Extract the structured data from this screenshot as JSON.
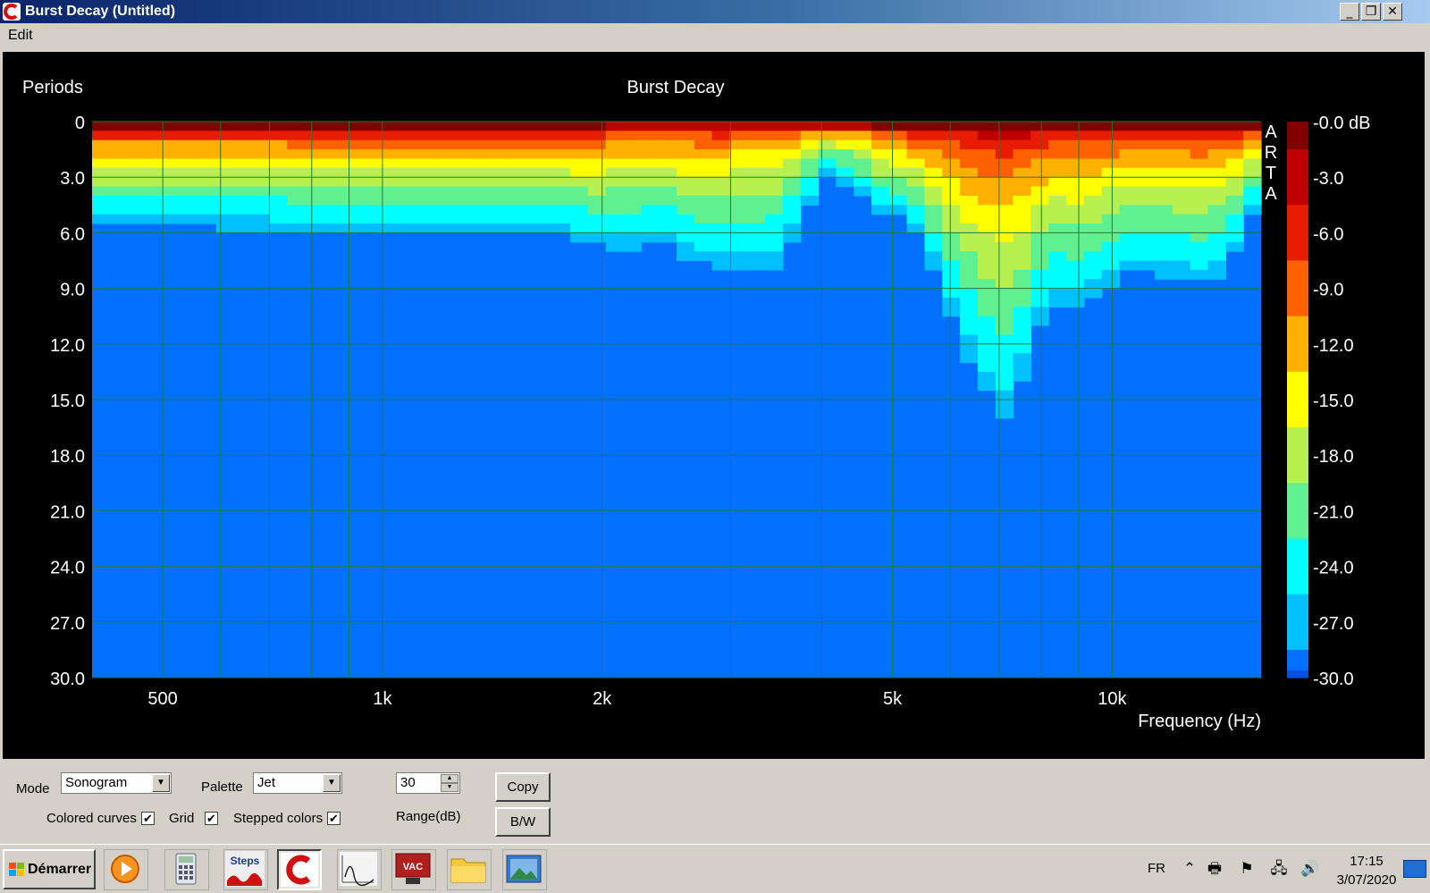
{
  "window": {
    "title": "Burst Decay  (Untitled)",
    "minimize_glyph": "_",
    "restore_glyph": "❐",
    "close_glyph": "✕"
  },
  "menu": {
    "edit_label": "Edit"
  },
  "chart_data": {
    "type": "heatmap",
    "title": "Burst Decay",
    "ylabel": "Periods",
    "xlabel": "Frequency (Hz)",
    "x_scale": "log",
    "xlim": [
      400,
      16000
    ],
    "ylim": [
      0,
      30
    ],
    "y_inverted": true,
    "x_ticks": [
      {
        "value": 500,
        "label": "500"
      },
      {
        "value": 1000,
        "label": "1k"
      },
      {
        "value": 2000,
        "label": "2k"
      },
      {
        "value": 5000,
        "label": "5k"
      },
      {
        "value": 10000,
        "label": "10k"
      }
    ],
    "x_grid": [
      500,
      600,
      700,
      800,
      900,
      1000,
      2000,
      3000,
      4000,
      5000,
      6000,
      7000,
      8000,
      9000,
      10000
    ],
    "y_ticks": [
      0,
      3,
      6,
      9,
      12,
      15,
      18,
      21,
      24,
      27,
      30
    ],
    "y_tick_labels": [
      "0",
      "3.0",
      "6.0",
      "9.0",
      "12.0",
      "15.0",
      "18.0",
      "21.0",
      "24.0",
      "27.0",
      "30.0"
    ],
    "grid": true,
    "watermark": [
      "A",
      "R",
      "T",
      "A"
    ],
    "colorbar": {
      "range_db": [
        0,
        -30
      ],
      "labels": [
        "-0.0 dB",
        "-3.0",
        "-6.0",
        "-9.0",
        "-12.0",
        "-15.0",
        "-18.0",
        "-21.0",
        "-24.0",
        "-27.0",
        "-30.0"
      ],
      "colors": [
        "#800000",
        "#c00000",
        "#e81c00",
        "#ff6000",
        "#ffb000",
        "#ffff00",
        "#b8f050",
        "#60f090",
        "#00ffff",
        "#00c0ff",
        "#0070ff"
      ]
    },
    "background_level_db": -30,
    "top_level_db": -1.5,
    "decay_contour": [
      [
        400,
        5.5
      ],
      [
        600,
        5.5
      ],
      [
        800,
        5.6
      ],
      [
        1000,
        5.7
      ],
      [
        1400,
        5.8
      ],
      [
        1800,
        6.0
      ],
      [
        2000,
        6.5
      ],
      [
        2200,
        6.7
      ],
      [
        2400,
        6.0
      ],
      [
        2600,
        7.0
      ],
      [
        2800,
        7.4
      ],
      [
        3000,
        7.6
      ],
      [
        3200,
        8.0
      ],
      [
        3500,
        7.4
      ],
      [
        3800,
        4.5
      ],
      [
        4100,
        2.6
      ],
      [
        4400,
        3.5
      ],
      [
        4800,
        4.8
      ],
      [
        5300,
        5.0
      ],
      [
        5800,
        8.5
      ],
      [
        6200,
        11.5
      ],
      [
        6600,
        14.0
      ],
      [
        7000,
        15.5
      ],
      [
        7300,
        16.2
      ],
      [
        7700,
        12.0
      ],
      [
        8200,
        9.5
      ],
      [
        9000,
        10.0
      ],
      [
        9600,
        9.0
      ],
      [
        10400,
        8.0
      ],
      [
        11500,
        8.0
      ],
      [
        12500,
        8.2
      ],
      [
        13500,
        8.5
      ],
      [
        14500,
        7.5
      ],
      [
        15200,
        5.0
      ],
      [
        16000,
        4.5
      ]
    ]
  },
  "controls": {
    "mode_label": "Mode",
    "mode_value": "Sonogram",
    "palette_label": "Palette",
    "palette_value": "Jet",
    "range_value": "30",
    "range_label": "Range(dB)",
    "copy_label": "Copy",
    "bw_label": "B/W",
    "colored_curves_label": "Colored curves",
    "grid_label": "Grid",
    "stepped_colors_label": "Stepped colors",
    "check_glyph": "✔"
  },
  "taskbar": {
    "start_label": "Démarrer",
    "apps": [
      "media-player",
      "calculator",
      "steps",
      "arta",
      "limp",
      "vac",
      "file-explorer",
      "photo-viewer"
    ],
    "steps_label": "Steps",
    "vac_label": "VAC",
    "lang": "FR",
    "time": "17:15",
    "date": "3/07/2020"
  }
}
